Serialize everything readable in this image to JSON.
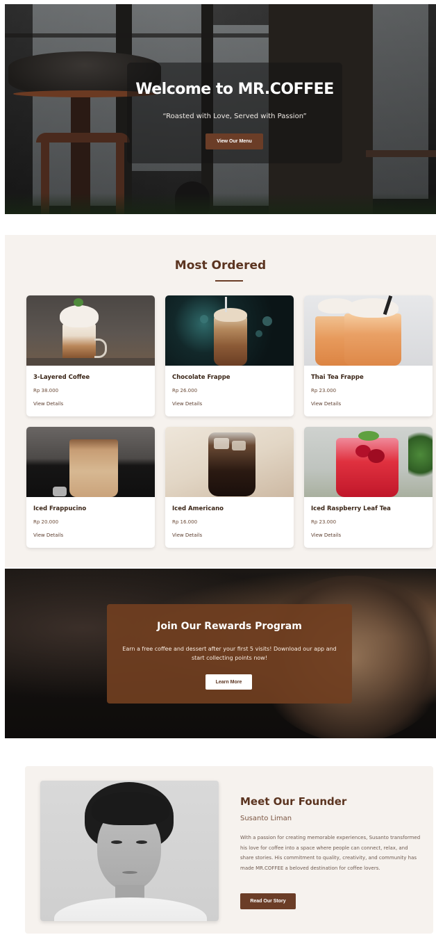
{
  "hero": {
    "title": "Welcome to MR.COFFEE",
    "subtitle": "“Roasted with Love, Served with Passion”",
    "button_label": "View Our Menu"
  },
  "menu": {
    "title": "Most Ordered",
    "items": [
      {
        "name": "3-Layered Coffee",
        "price": "Rp 38.000",
        "details_label": "View Details"
      },
      {
        "name": "Chocolate Frappe",
        "price": "Rp 26.000",
        "details_label": "View Details"
      },
      {
        "name": "Thai Tea Frappe",
        "price": "Rp 23.000",
        "details_label": "View Details"
      },
      {
        "name": "Iced Frappucino",
        "price": "Rp 20.000",
        "details_label": "View Details"
      },
      {
        "name": "Iced Americano",
        "price": "Rp 16.000",
        "details_label": "View Details"
      },
      {
        "name": "Iced Raspberry Leaf Tea",
        "price": "Rp 23.000",
        "details_label": "View Details"
      }
    ]
  },
  "rewards": {
    "title": "Join Our Rewards Program",
    "text": "Earn a free coffee and dessert after your first 5 visits! Download our app and start collecting points now!",
    "button_label": "Learn More"
  },
  "founder": {
    "title": "Meet Our Founder",
    "name": "Susanto Liman",
    "bio": "With a passion for creating memorable experiences, Susanto transformed his love for coffee into a space where people can connect, relax, and share stories. His commitment to quality, creativity, and community has made MR.COFFEE a beloved destination for coffee lovers.",
    "button_label": "Read Our Story"
  },
  "colors": {
    "brand_brown": "#6b3d27",
    "heading_brown": "#5b3420",
    "section_bg": "#f6f2ee"
  }
}
